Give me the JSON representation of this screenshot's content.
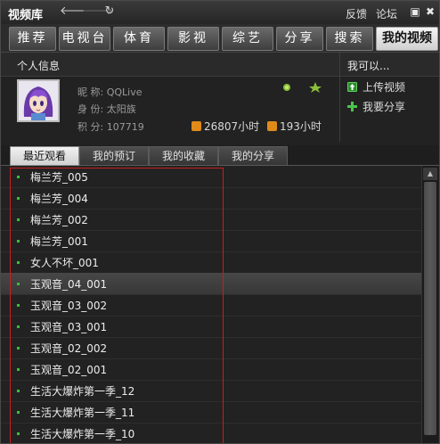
{
  "titlebar": {
    "title": "视频库",
    "back_icon": "arrow-left-icon",
    "forward_icon": "arrow-right-icon",
    "refresh_icon": "refresh-icon",
    "feedback": "反馈",
    "forum": "论坛",
    "maximize_icon": "maximize-icon",
    "close_icon": "close-icon"
  },
  "tabs": [
    {
      "label": "推荐"
    },
    {
      "label": "电视台"
    },
    {
      "label": "体育"
    },
    {
      "label": "影视"
    },
    {
      "label": "综艺"
    },
    {
      "label": "分享"
    },
    {
      "label": "搜索"
    },
    {
      "label": "我的视频",
      "active": true
    }
  ],
  "profile": {
    "header": "个人信息",
    "nickname_label": "昵 称:",
    "nickname": "QQLive",
    "identity_label": "身 份:",
    "identity": "太阳族",
    "points_label": "积 分:",
    "points": "107719",
    "watch_time": "26807小时",
    "share_time": "193小时"
  },
  "can_do": {
    "header": "我可以...",
    "upload": "上传视频",
    "share": "我要分享"
  },
  "subtabs": [
    {
      "label": "最近观看",
      "active": true
    },
    {
      "label": "我的预订"
    },
    {
      "label": "我的收藏"
    },
    {
      "label": "我的分享"
    }
  ],
  "history": [
    {
      "title": "梅兰芳_005"
    },
    {
      "title": "梅兰芳_004"
    },
    {
      "title": "梅兰芳_002"
    },
    {
      "title": "梅兰芳_001"
    },
    {
      "title": "女人不坏_001"
    },
    {
      "title": "玉观音_04_001",
      "highlighted": true
    },
    {
      "title": "玉观音_03_002"
    },
    {
      "title": "玉观音_03_001"
    },
    {
      "title": "玉观音_02_002"
    },
    {
      "title": "玉观音_02_001"
    },
    {
      "title": "生活大爆炸第一季_12"
    },
    {
      "title": "生活大爆炸第一季_11"
    },
    {
      "title": "生活大爆炸第一季_10"
    }
  ],
  "colors": {
    "accent_green": "#3bbf3b",
    "highlight_box": "#c81e1e",
    "clock_orange": "#e08a1a"
  }
}
